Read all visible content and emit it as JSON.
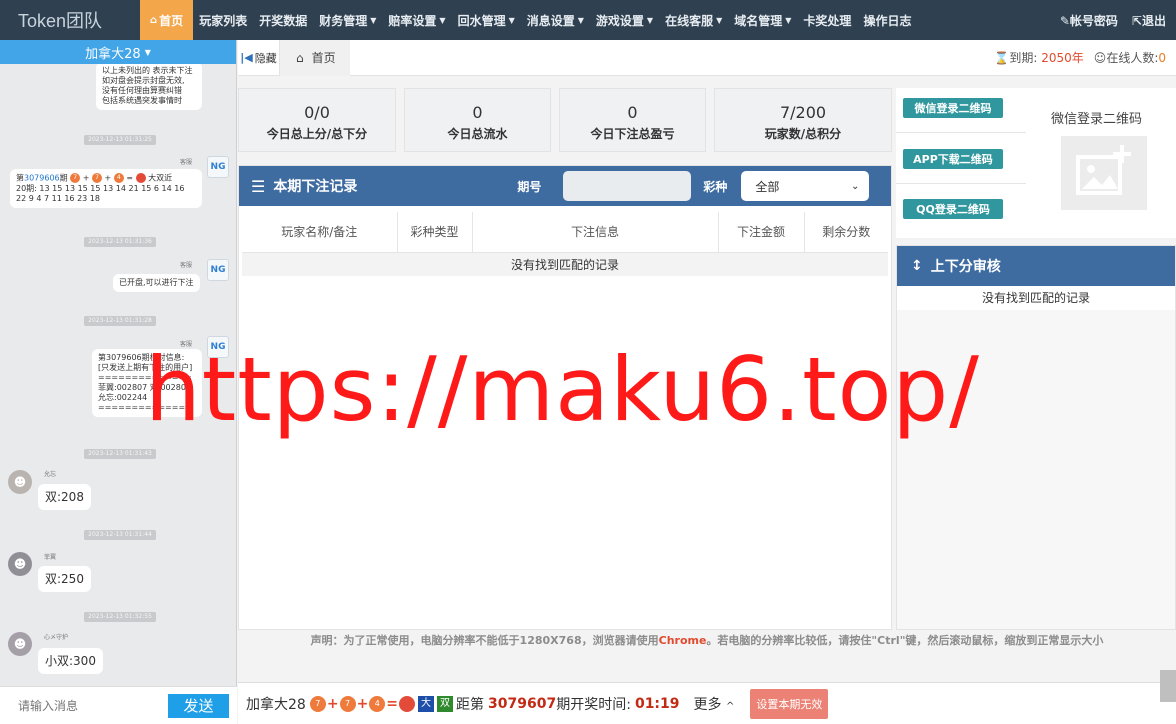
{
  "brand": "Token团队",
  "nav": [
    {
      "label": "首页",
      "active": true
    },
    {
      "label": "玩家列表"
    },
    {
      "label": "开奖数据"
    },
    {
      "label": "财务管理",
      "caret": true
    },
    {
      "label": "赔率设置",
      "caret": true
    },
    {
      "label": "回水管理",
      "caret": true
    },
    {
      "label": "消息设置",
      "caret": true
    },
    {
      "label": "游戏设置",
      "caret": true
    },
    {
      "label": "在线客服",
      "caret": true
    },
    {
      "label": "域名管理",
      "caret": true
    },
    {
      "label": "卡奖处理"
    },
    {
      "label": "操作日志"
    }
  ],
  "top_right": {
    "account": "帐号密码",
    "logout": "退出"
  },
  "chat": {
    "header": "加拿大28",
    "messages": [
      {
        "text_lines": [
          "以上未列出的 表示未下注",
          "如对盘会提示封盘无效,",
          "没有任何理由算赛纠错",
          "包括系统遇突发事情时"
        ]
      },
      {
        "timestamp": "2023-12-13 01:31:25"
      },
      {
        "sender": "客服",
        "period_prefix": "第",
        "period": "3079606",
        "period_suffix": "期",
        "balls": [
          "7",
          "7",
          "4"
        ],
        "sum": "18",
        "result": "大双近",
        "history": "20期: 13 15 13 15 15 13 14 21 15 6 14 16 22 9 4 7 11 16 23 18"
      },
      {
        "timestamp": "2023-12-13 01:31:36"
      },
      {
        "sender": "客服",
        "text": "已开盘,可以进行下注"
      },
      {
        "timestamp": "2023-12-13 01:31:28"
      },
      {
        "sender": "客服",
        "text_lines": [
          "第3079606期核对信息:",
          "[只发送上期有下注的用户]",
          "==============",
          "菲翼:002807 双:002806",
          "允忘:002244",
          "=============="
        ]
      },
      {
        "timestamp": "2023-12-13 01:31:43",
        "sender": "允忘",
        "text": "双:208"
      },
      {
        "timestamp": "2023-12-13 01:31:44",
        "sender": "菲翼",
        "text": "双:250"
      },
      {
        "timestamp": "2023-12-13 01:32:55",
        "sender": "心メ守护",
        "text": "小双:300"
      }
    ],
    "input_placeholder": "请输入消息",
    "send_label": "发送"
  },
  "tabs": {
    "hide_label": "隐藏",
    "home_label": "首页"
  },
  "expire": {
    "label": "到期:",
    "value": "2050年",
    "online_label": "在线人数:",
    "online_value": "0"
  },
  "stats": [
    {
      "value": "0/0",
      "label": "今日总上分/总下分"
    },
    {
      "value": "0",
      "label": "今日总流水"
    },
    {
      "value": "0",
      "label": "今日下注总盈亏"
    },
    {
      "value": "7/200",
      "label": "玩家数/总积分"
    }
  ],
  "records": {
    "title": "本期下注记录",
    "period_label": "期号",
    "period_value": "",
    "lottery_label": "彩种",
    "lottery_selected": "全部",
    "columns": [
      "玩家名称/备注",
      "彩种类型",
      "下注信息",
      "下注金额",
      "剩余分数"
    ],
    "empty": "没有找到匹配的记录"
  },
  "qr": {
    "wechat_btn": "微信登录二维码",
    "app_btn": "APP下载二维码",
    "qq_btn": "QQ登录二维码",
    "title": "微信登录二维码"
  },
  "audit": {
    "title": "上下分审核",
    "empty": "没有找到匹配的记录"
  },
  "notice": {
    "before": "声明：为了正常使用，电脑分辨率不能低于1280X768，浏览器请使用",
    "chrome": "Chrome",
    "after": "。若电脑的分辨率比较低，请按住\"Ctrl\"键，然后滚动鼠标，缩放到正常显示大小"
  },
  "bottom": {
    "game": "加拿大28",
    "balls": [
      "7",
      "7",
      "4"
    ],
    "sum": "18",
    "big": "大",
    "even": "双",
    "next_prefix": "距第",
    "next_period": "3079607",
    "next_suffix": "期开奖时间:",
    "countdown": "01:19",
    "more": "更多",
    "invalid_btn": "设置本期无效"
  },
  "watermark": "https://maku6.top/",
  "colors": {
    "topbar": "#2f4050",
    "accent": "#f4a64b",
    "panel_header": "#3e6ca1",
    "qr_button": "#31979e",
    "chat_header": "#42a5e8"
  }
}
